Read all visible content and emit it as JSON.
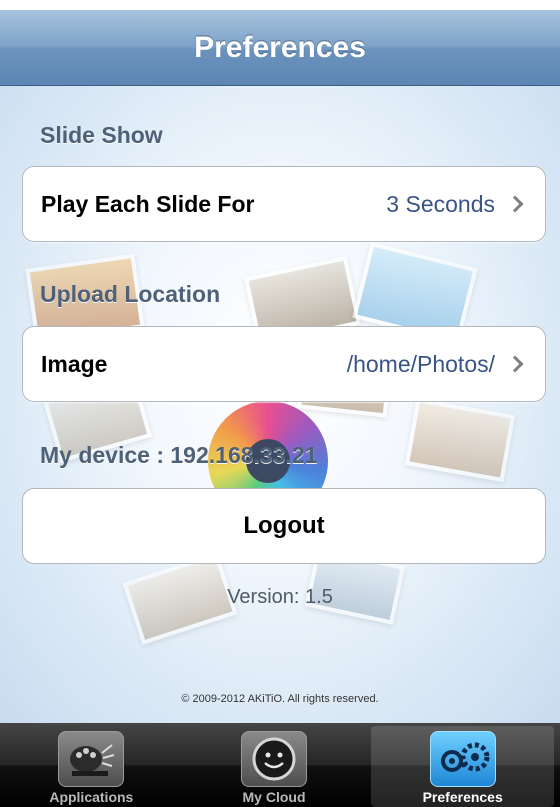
{
  "navbar": {
    "title": "Preferences"
  },
  "slideshow": {
    "header": "Slide Show",
    "label": "Play Each Slide For",
    "value": "3 Seconds"
  },
  "upload": {
    "header": "Upload Location",
    "label": "Image",
    "value": "/home/Photos/"
  },
  "device": {
    "text": "My device : 192.168.33.21"
  },
  "logout": {
    "label": "Logout"
  },
  "version": {
    "text": "Version: 1.5"
  },
  "copyright": {
    "text": "© 2009-2012 AKiTiO. All rights reserved."
  },
  "tabs": [
    {
      "label": "Applications",
      "icon": "palette-icon"
    },
    {
      "label": "My Cloud",
      "icon": "cloud-smile-icon"
    },
    {
      "label": "Preferences",
      "icon": "gears-icon"
    }
  ],
  "colors": {
    "navbar": "#6b93bd",
    "value_text": "#385487",
    "tab_active": "#1f86d6"
  }
}
